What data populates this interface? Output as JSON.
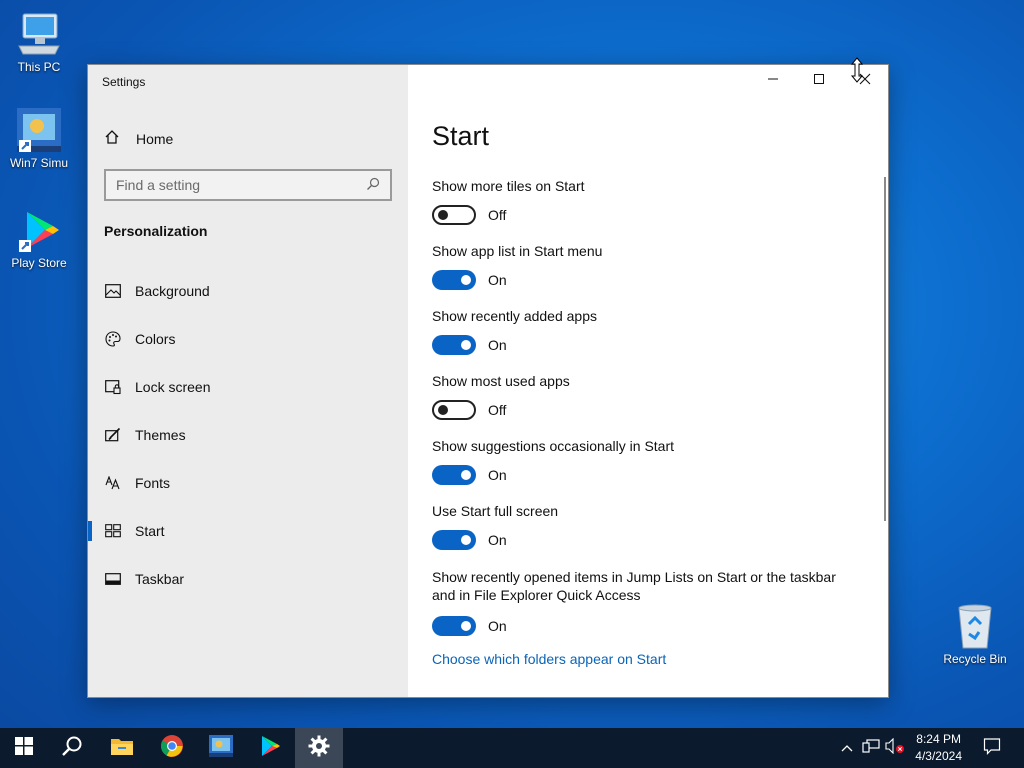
{
  "desktop": {
    "icons": [
      {
        "label": "This PC",
        "icon": "this-pc-icon"
      },
      {
        "label": "Win7 Simu",
        "icon": "win7-simu-icon"
      },
      {
        "label": "Play Store",
        "icon": "play-store-icon"
      },
      {
        "label": "Recycle Bin",
        "icon": "recycle-bin-icon"
      }
    ]
  },
  "window": {
    "title": "Settings",
    "controls": {
      "minimize": "minimize-icon",
      "maximize": "maximize-icon",
      "close": "close-icon"
    }
  },
  "sidebar": {
    "home_label": "Home",
    "search_placeholder": "Find a setting",
    "section_title": "Personalization",
    "items": [
      {
        "label": "Background",
        "icon": "picture-icon"
      },
      {
        "label": "Colors",
        "icon": "palette-icon"
      },
      {
        "label": "Lock screen",
        "icon": "lock-screen-icon"
      },
      {
        "label": "Themes",
        "icon": "themes-icon"
      },
      {
        "label": "Fonts",
        "icon": "fonts-icon"
      },
      {
        "label": "Start",
        "icon": "start-layout-icon",
        "active": true
      },
      {
        "label": "Taskbar",
        "icon": "taskbar-icon"
      }
    ]
  },
  "content": {
    "title": "Start",
    "settings": [
      {
        "label": "Show more tiles on Start",
        "state": "Off",
        "on": false
      },
      {
        "label": "Show app list in Start menu",
        "state": "On",
        "on": true
      },
      {
        "label": "Show recently added apps",
        "state": "On",
        "on": true
      },
      {
        "label": "Show most used apps",
        "state": "Off",
        "on": false
      },
      {
        "label": "Show suggestions occasionally in Start",
        "state": "On",
        "on": true
      },
      {
        "label": "Use Start full screen",
        "state": "On",
        "on": true
      },
      {
        "label": "Show recently opened items in Jump Lists on Start or the taskbar and in File Explorer Quick Access",
        "state": "On",
        "on": true
      }
    ],
    "link": "Choose which folders appear on Start"
  },
  "taskbar": {
    "apps": [
      "start-icon",
      "search-icon",
      "file-explorer-icon",
      "chrome-icon",
      "win7-simu-icon",
      "play-store-icon",
      "settings-icon"
    ],
    "clock": {
      "time": "8:24 PM",
      "date": "4/3/2024"
    }
  },
  "colors": {
    "accent": "#0a64c6",
    "link": "#0a64b8",
    "taskbar": "#0c1a2e"
  }
}
